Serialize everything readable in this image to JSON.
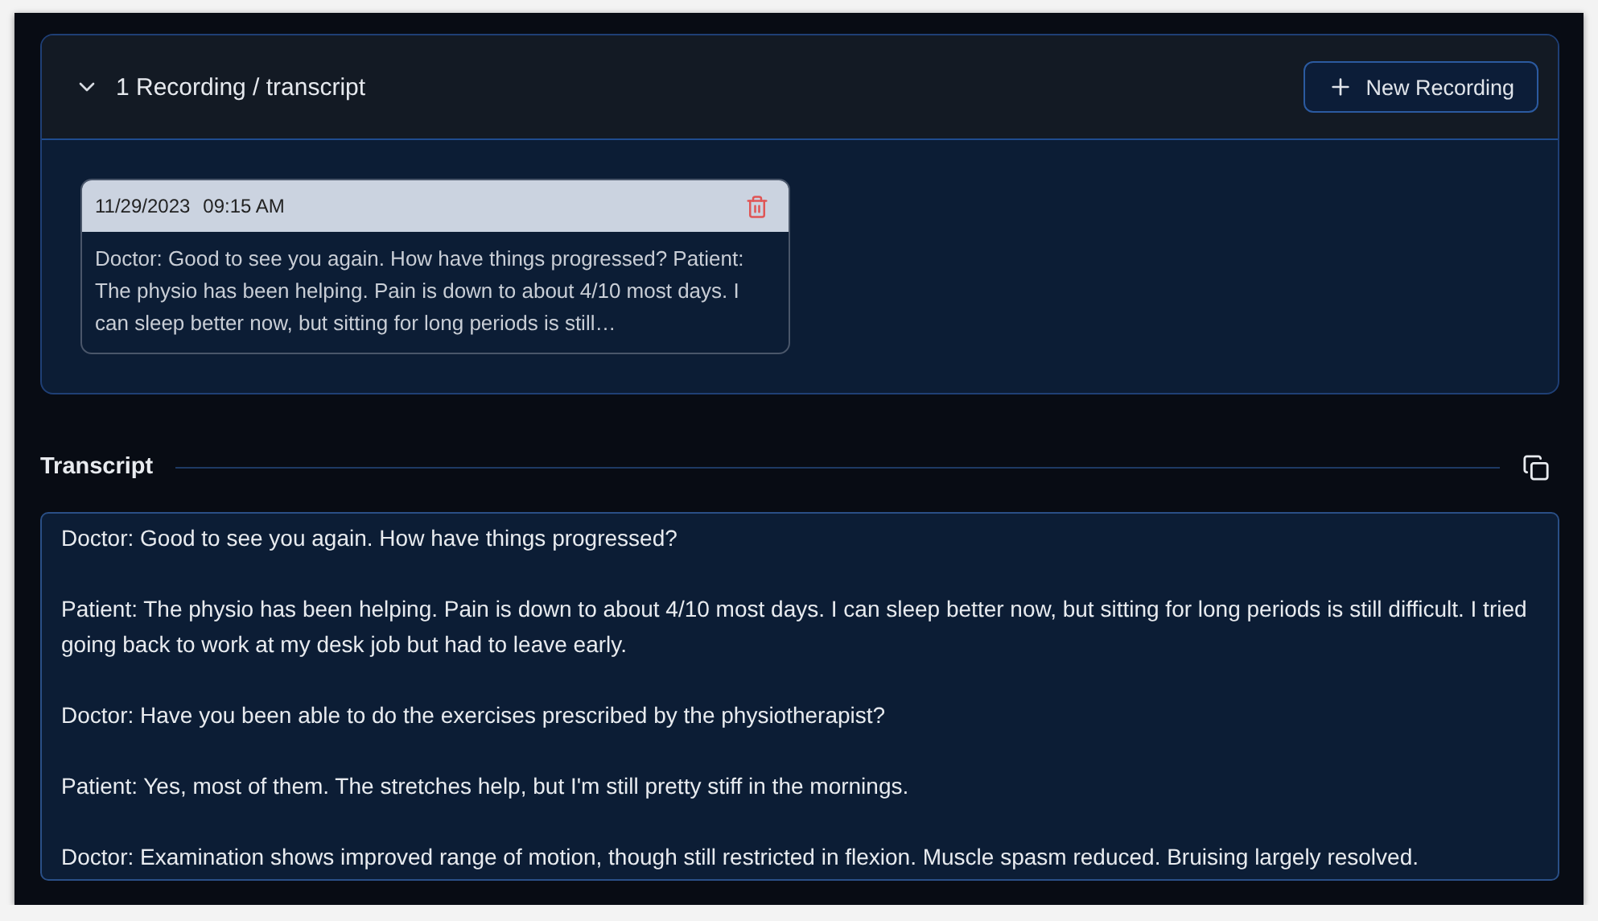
{
  "recordings_panel": {
    "title": "1 Recording / transcript",
    "expanded": true,
    "new_button": "New Recording",
    "recordings": [
      {
        "date": "11/29/2023",
        "time": "09:15 AM",
        "preview": "Doctor: Good to see you again. How have things progressed? Patient: The physio has been helping. Pain is down to about 4/10 most days. I can sleep better now, but sitting for long periods is still…"
      }
    ]
  },
  "transcript": {
    "title": "Transcript",
    "paragraphs": [
      "Doctor: Good to see you again. How have things progressed?",
      "Patient: The physio has been helping. Pain is down to about 4/10 most days. I can sleep better now, but sitting for long periods is still difficult. I tried going back to work at my desk job but had to leave early.",
      "Doctor: Have you been able to do the exercises prescribed by the physiotherapist?",
      "Patient: Yes, most of them. The stretches help, but I'm still pretty stiff in the mornings.",
      "Doctor: Examination shows improved range of motion, though still restricted in flexion. Muscle spasm reduced. Bruising largely resolved."
    ]
  }
}
